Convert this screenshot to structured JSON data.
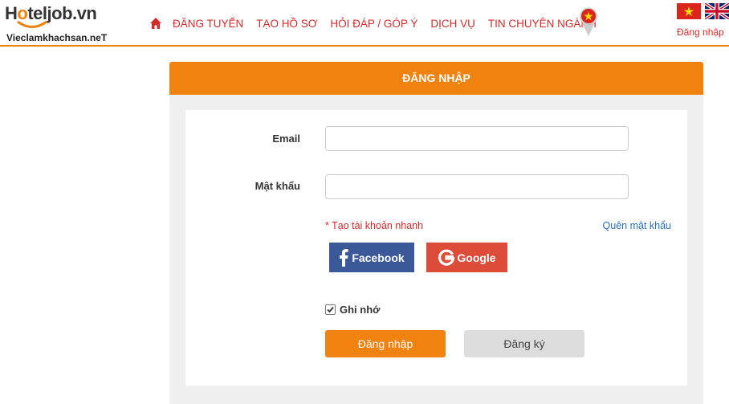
{
  "brand": {
    "logo_text_1": "H",
    "logo_text_2": "o",
    "logo_text_3": "teljob.vn",
    "logo_subtext": "Vieclamkhachsan.neT",
    "accent_color": "#f0820f",
    "nav_color": "#d32b2b"
  },
  "nav": {
    "home_icon": "home-icon",
    "items": [
      "ĐĂNG TUYỂN",
      "TẠO HỒ SƠ",
      "HỎI ĐÁP / GÓP Ý",
      "DỊCH VỤ",
      "TIN CHUYÊN NGÀNH"
    ],
    "location_icon": "location-pin-icon"
  },
  "lang": {
    "vn_icon": "vietnam-flag-icon",
    "uk_icon": "uk-flag-icon",
    "login_link": "Đăng nhập"
  },
  "form": {
    "title": "ĐĂNG NHẬP",
    "email_label": "Email",
    "email_value": "",
    "password_label": "Mật khẩu",
    "password_value": "",
    "quick_signup": "* Tạo tài khoản nhanh",
    "forgot_password": "Quên mật khẩu",
    "facebook_label": "Facebook",
    "google_label": "Google",
    "remember_label": "Ghi nhớ",
    "remember_checked": true,
    "login_button": "Đăng nhập",
    "register_button": "Đăng ký"
  }
}
